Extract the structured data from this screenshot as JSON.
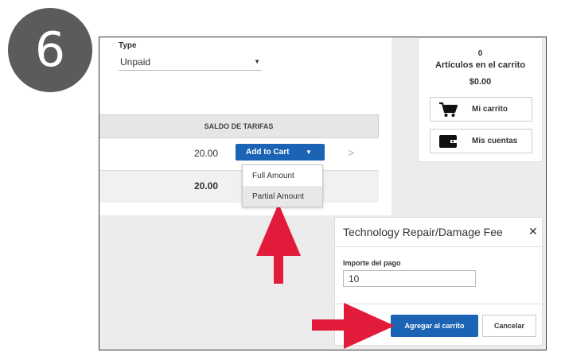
{
  "step_number": "6",
  "type_field": {
    "label": "Type",
    "value": "Unpaid"
  },
  "fee_table": {
    "header": "SALDO DE TARIFAS",
    "row_amount": "20.00",
    "total_amount": "20.00",
    "add_to_cart_label": "Add to Cart"
  },
  "dropdown_options": [
    "Full Amount",
    "Partial Amount"
  ],
  "cart": {
    "count": "0",
    "label": "Artículos en el carrito",
    "total": "$0.00",
    "my_cart_label": "Mi carrito",
    "my_accounts_label": "Mis cuentas"
  },
  "modal": {
    "title": "Technology Repair/Damage Fee",
    "payment_label": "Importe del pago",
    "payment_value": "10",
    "add_button": "Agregar al carrito",
    "cancel_button": "Cancelar"
  },
  "colors": {
    "primary_blue": "#1a63b5",
    "annotation_red": "#e31b3b",
    "badge_gray": "#5b5b5b"
  }
}
